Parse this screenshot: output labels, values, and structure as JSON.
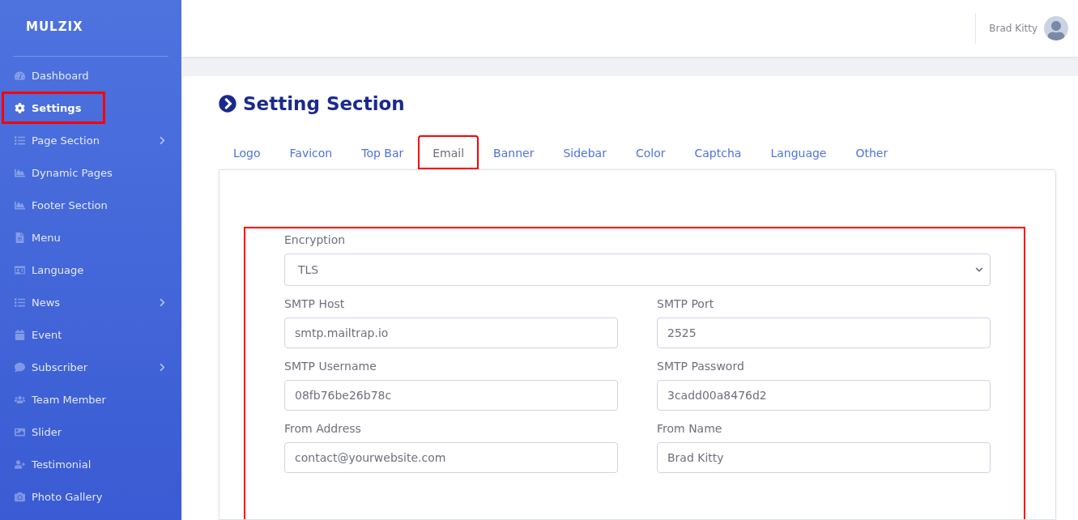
{
  "brand": "MULZIX",
  "sidebar": {
    "items": [
      {
        "label": "Dashboard",
        "selected": false,
        "highlighted": false,
        "submenu": false
      },
      {
        "label": "Settings",
        "selected": true,
        "highlighted": true,
        "submenu": false
      },
      {
        "label": "Page Section",
        "selected": false,
        "highlighted": false,
        "submenu": true
      },
      {
        "label": "Dynamic Pages",
        "selected": false,
        "highlighted": false,
        "submenu": false
      },
      {
        "label": "Footer Section",
        "selected": false,
        "highlighted": false,
        "submenu": false
      },
      {
        "label": "Menu",
        "selected": false,
        "highlighted": false,
        "submenu": false
      },
      {
        "label": "Language",
        "selected": false,
        "highlighted": false,
        "submenu": false
      },
      {
        "label": "News",
        "selected": false,
        "highlighted": false,
        "submenu": true
      },
      {
        "label": "Event",
        "selected": false,
        "highlighted": false,
        "submenu": false
      },
      {
        "label": "Subscriber",
        "selected": false,
        "highlighted": false,
        "submenu": true
      },
      {
        "label": "Team Member",
        "selected": false,
        "highlighted": false,
        "submenu": false
      },
      {
        "label": "Slider",
        "selected": false,
        "highlighted": false,
        "submenu": false
      },
      {
        "label": "Testimonial",
        "selected": false,
        "highlighted": false,
        "submenu": false
      },
      {
        "label": "Photo Gallery",
        "selected": false,
        "highlighted": false,
        "submenu": false
      }
    ]
  },
  "user": {
    "name": "Brad Kitty"
  },
  "page": {
    "title": "Setting Section"
  },
  "tabs": [
    {
      "label": "Logo",
      "selected": false,
      "highlighted": false
    },
    {
      "label": "Favicon",
      "selected": false,
      "highlighted": false
    },
    {
      "label": "Top Bar",
      "selected": false,
      "highlighted": false
    },
    {
      "label": "Email",
      "selected": true,
      "highlighted": true
    },
    {
      "label": "Banner",
      "selected": false,
      "highlighted": false
    },
    {
      "label": "Sidebar",
      "selected": false,
      "highlighted": false
    },
    {
      "label": "Color",
      "selected": false,
      "highlighted": false
    },
    {
      "label": "Captcha",
      "selected": false,
      "highlighted": false
    },
    {
      "label": "Language",
      "selected": false,
      "highlighted": false
    },
    {
      "label": "Other",
      "selected": false,
      "highlighted": false
    }
  ],
  "form": {
    "highlighted": true,
    "fields": [
      {
        "kind": "select",
        "label": "Encryption",
        "value": "TLS",
        "full": true
      },
      {
        "kind": "text",
        "label": "SMTP Host",
        "value": "smtp.mailtrap.io",
        "full": false
      },
      {
        "kind": "text",
        "label": "SMTP Port",
        "value": "2525",
        "full": false
      },
      {
        "kind": "text",
        "label": "SMTP Username",
        "value": "08fb76be26b78c",
        "full": false
      },
      {
        "kind": "text",
        "label": "SMTP Password",
        "value": "3cadd00a8476d2",
        "full": false
      },
      {
        "kind": "text",
        "label": "From Address",
        "value": "contact@yourwebsite.com",
        "full": false
      },
      {
        "kind": "text",
        "label": "From Name",
        "value": "Brad Kitty",
        "full": false
      }
    ]
  }
}
